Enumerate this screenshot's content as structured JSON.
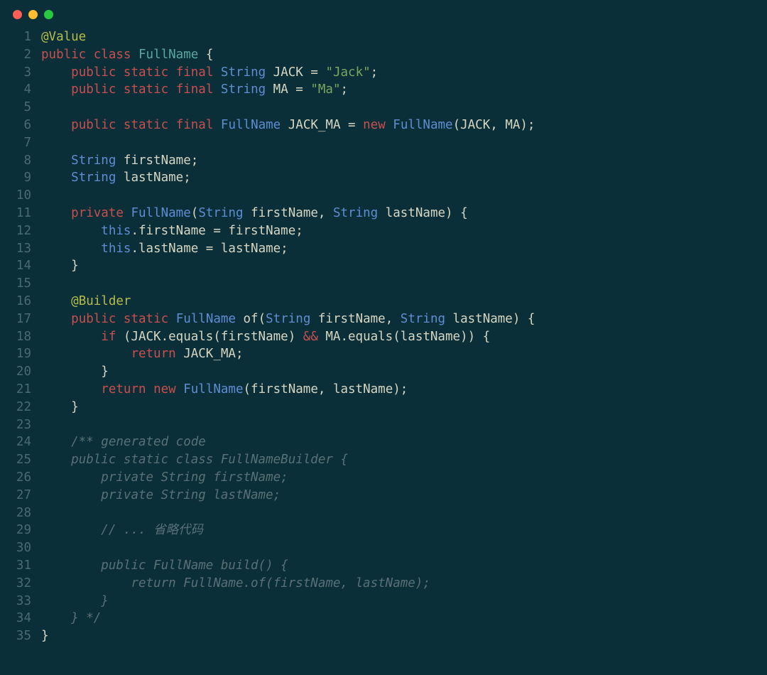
{
  "window": {
    "buttons": {
      "close": "#ff5f57",
      "min": "#febc2e",
      "max": "#28c840"
    }
  },
  "colors": {
    "annotation": "#b7bc4b",
    "keyword": "#c94f4f",
    "type": "#5f8dd3",
    "classname": "#5aa89f",
    "ident": "#d6d6c2",
    "string": "#7aa65f",
    "comment": "#5a6f76"
  },
  "code": {
    "lines": [
      [
        {
          "c": "annotation",
          "t": "@Value"
        }
      ],
      [
        {
          "c": "keyword",
          "t": "public"
        },
        {
          "c": "ident",
          "t": " "
        },
        {
          "c": "keyword",
          "t": "class"
        },
        {
          "c": "ident",
          "t": " "
        },
        {
          "c": "classname",
          "t": "FullName"
        },
        {
          "c": "ident",
          "t": " {"
        }
      ],
      [
        {
          "c": "ident",
          "t": "    "
        },
        {
          "c": "keyword",
          "t": "public"
        },
        {
          "c": "ident",
          "t": " "
        },
        {
          "c": "keyword",
          "t": "static"
        },
        {
          "c": "ident",
          "t": " "
        },
        {
          "c": "keyword",
          "t": "final"
        },
        {
          "c": "ident",
          "t": " "
        },
        {
          "c": "type",
          "t": "String"
        },
        {
          "c": "ident",
          "t": " JACK = "
        },
        {
          "c": "string",
          "t": "\"Jack\""
        },
        {
          "c": "ident",
          "t": ";"
        }
      ],
      [
        {
          "c": "ident",
          "t": "    "
        },
        {
          "c": "keyword",
          "t": "public"
        },
        {
          "c": "ident",
          "t": " "
        },
        {
          "c": "keyword",
          "t": "static"
        },
        {
          "c": "ident",
          "t": " "
        },
        {
          "c": "keyword",
          "t": "final"
        },
        {
          "c": "ident",
          "t": " "
        },
        {
          "c": "type",
          "t": "String"
        },
        {
          "c": "ident",
          "t": " MA = "
        },
        {
          "c": "string",
          "t": "\"Ma\""
        },
        {
          "c": "ident",
          "t": ";"
        }
      ],
      [
        {
          "c": "ident",
          "t": ""
        }
      ],
      [
        {
          "c": "ident",
          "t": "    "
        },
        {
          "c": "keyword",
          "t": "public"
        },
        {
          "c": "ident",
          "t": " "
        },
        {
          "c": "keyword",
          "t": "static"
        },
        {
          "c": "ident",
          "t": " "
        },
        {
          "c": "keyword",
          "t": "final"
        },
        {
          "c": "ident",
          "t": " "
        },
        {
          "c": "type",
          "t": "FullName"
        },
        {
          "c": "ident",
          "t": " JACK_MA = "
        },
        {
          "c": "keyword",
          "t": "new"
        },
        {
          "c": "ident",
          "t": " "
        },
        {
          "c": "type",
          "t": "FullName"
        },
        {
          "c": "ident",
          "t": "(JACK, MA);"
        }
      ],
      [
        {
          "c": "ident",
          "t": ""
        }
      ],
      [
        {
          "c": "ident",
          "t": "    "
        },
        {
          "c": "type",
          "t": "String"
        },
        {
          "c": "ident",
          "t": " firstName;"
        }
      ],
      [
        {
          "c": "ident",
          "t": "    "
        },
        {
          "c": "type",
          "t": "String"
        },
        {
          "c": "ident",
          "t": " lastName;"
        }
      ],
      [
        {
          "c": "ident",
          "t": ""
        }
      ],
      [
        {
          "c": "ident",
          "t": "    "
        },
        {
          "c": "keyword",
          "t": "private"
        },
        {
          "c": "ident",
          "t": " "
        },
        {
          "c": "type",
          "t": "FullName"
        },
        {
          "c": "ident",
          "t": "("
        },
        {
          "c": "type",
          "t": "String"
        },
        {
          "c": "ident",
          "t": " firstName, "
        },
        {
          "c": "type",
          "t": "String"
        },
        {
          "c": "ident",
          "t": " lastName) {"
        }
      ],
      [
        {
          "c": "ident",
          "t": "        "
        },
        {
          "c": "this",
          "t": "this"
        },
        {
          "c": "ident",
          "t": ".firstName = firstName;"
        }
      ],
      [
        {
          "c": "ident",
          "t": "        "
        },
        {
          "c": "this",
          "t": "this"
        },
        {
          "c": "ident",
          "t": ".lastName = lastName;"
        }
      ],
      [
        {
          "c": "ident",
          "t": "    }"
        }
      ],
      [
        {
          "c": "ident",
          "t": ""
        }
      ],
      [
        {
          "c": "ident",
          "t": "    "
        },
        {
          "c": "annotation",
          "t": "@Builder"
        }
      ],
      [
        {
          "c": "ident",
          "t": "    "
        },
        {
          "c": "keyword",
          "t": "public"
        },
        {
          "c": "ident",
          "t": " "
        },
        {
          "c": "keyword",
          "t": "static"
        },
        {
          "c": "ident",
          "t": " "
        },
        {
          "c": "type",
          "t": "FullName"
        },
        {
          "c": "ident",
          "t": " of("
        },
        {
          "c": "type",
          "t": "String"
        },
        {
          "c": "ident",
          "t": " firstName, "
        },
        {
          "c": "type",
          "t": "String"
        },
        {
          "c": "ident",
          "t": " lastName) {"
        }
      ],
      [
        {
          "c": "ident",
          "t": "        "
        },
        {
          "c": "keyword",
          "t": "if"
        },
        {
          "c": "ident",
          "t": " (JACK.equals(firstName) "
        },
        {
          "c": "keyword",
          "t": "&&"
        },
        {
          "c": "ident",
          "t": " MA.equals(lastName)) {"
        }
      ],
      [
        {
          "c": "ident",
          "t": "            "
        },
        {
          "c": "keyword",
          "t": "return"
        },
        {
          "c": "ident",
          "t": " JACK_MA;"
        }
      ],
      [
        {
          "c": "ident",
          "t": "        }"
        }
      ],
      [
        {
          "c": "ident",
          "t": "        "
        },
        {
          "c": "keyword",
          "t": "return"
        },
        {
          "c": "ident",
          "t": " "
        },
        {
          "c": "keyword",
          "t": "new"
        },
        {
          "c": "ident",
          "t": " "
        },
        {
          "c": "type",
          "t": "FullName"
        },
        {
          "c": "ident",
          "t": "(firstName, lastName);"
        }
      ],
      [
        {
          "c": "ident",
          "t": "    }"
        }
      ],
      [
        {
          "c": "ident",
          "t": ""
        }
      ],
      [
        {
          "c": "ident",
          "t": "    "
        },
        {
          "c": "comment",
          "t": "/** generated code"
        }
      ],
      [
        {
          "c": "ident",
          "t": "    "
        },
        {
          "c": "comment",
          "t": "public static class FullNameBuilder {"
        }
      ],
      [
        {
          "c": "ident",
          "t": "        "
        },
        {
          "c": "comment",
          "t": "private String firstName;"
        }
      ],
      [
        {
          "c": "ident",
          "t": "        "
        },
        {
          "c": "comment",
          "t": "private String lastName;"
        }
      ],
      [
        {
          "c": "ident",
          "t": ""
        }
      ],
      [
        {
          "c": "ident",
          "t": "        "
        },
        {
          "c": "comment",
          "t": "// ... 省略代码"
        }
      ],
      [
        {
          "c": "ident",
          "t": ""
        }
      ],
      [
        {
          "c": "ident",
          "t": "        "
        },
        {
          "c": "comment",
          "t": "public FullName build() {"
        }
      ],
      [
        {
          "c": "ident",
          "t": "            "
        },
        {
          "c": "comment",
          "t": "return FullName.of(firstName, lastName);"
        }
      ],
      [
        {
          "c": "ident",
          "t": "        "
        },
        {
          "c": "comment",
          "t": "}"
        }
      ],
      [
        {
          "c": "ident",
          "t": "    "
        },
        {
          "c": "comment",
          "t": "} */"
        }
      ],
      [
        {
          "c": "ident",
          "t": "}"
        }
      ]
    ]
  }
}
